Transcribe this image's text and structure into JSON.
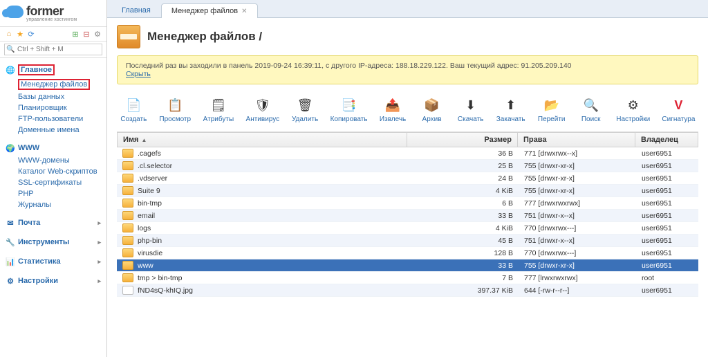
{
  "logo": {
    "text": "former",
    "sub": "управление хостингом"
  },
  "search": {
    "placeholder": "Ctrl + Shift + M"
  },
  "nav": {
    "main": {
      "label": "Главное",
      "items": [
        "Менеджер файлов",
        "Базы данных",
        "Планировщик",
        "FTP-пользователи",
        "Доменные имена"
      ]
    },
    "www": {
      "label": "WWW",
      "items": [
        "WWW-домены",
        "Каталог Web-скриптов",
        "SSL-сертификаты",
        "PHP",
        "Журналы"
      ]
    },
    "mail": {
      "label": "Почта"
    },
    "tools": {
      "label": "Инструменты"
    },
    "stats": {
      "label": "Статистика"
    },
    "settings": {
      "label": "Настройки"
    }
  },
  "tabs": {
    "home": "Главная",
    "fm": "Менеджер файлов"
  },
  "title": "Менеджер файлов /",
  "notice": {
    "text": "Последний раз вы заходили в панель 2019-09-24 16:39:11, с другого IP-адреса: 188.18.229.122. Ваш текущий адрес: 91.205.209.140",
    "hide": "Скрыть"
  },
  "toolbar": {
    "create": "Создать",
    "view": "Просмотр",
    "attrs": "Атрибуты",
    "antivirus": "Антивирус",
    "delete": "Удалить",
    "copy": "Копировать",
    "extract": "Извлечь",
    "archive": "Архив",
    "download": "Скачать",
    "upload": "Закачать",
    "goto": "Перейти",
    "search": "Поиск",
    "settings": "Настройки",
    "signature": "Сигнатура"
  },
  "columns": {
    "name": "Имя",
    "size": "Размер",
    "perm": "Права",
    "owner": "Владелец"
  },
  "rows": [
    {
      "name": ".cagefs",
      "size": "36 B",
      "perm": "771 [drwxrwx--x]",
      "owner": "user6951",
      "type": "dir",
      "selected": false
    },
    {
      "name": ".cl.selector",
      "size": "25 B",
      "perm": "755 [drwxr-xr-x]",
      "owner": "user6951",
      "type": "dir",
      "selected": false
    },
    {
      "name": ".vdserver",
      "size": "24 B",
      "perm": "755 [drwxr-xr-x]",
      "owner": "user6951",
      "type": "dir",
      "selected": false
    },
    {
      "name": "Suite 9",
      "size": "4 KiB",
      "perm": "755 [drwxr-xr-x]",
      "owner": "user6951",
      "type": "dir",
      "selected": false
    },
    {
      "name": "bin-tmp",
      "size": "6 B",
      "perm": "777 [drwxrwxrwx]",
      "owner": "user6951",
      "type": "dir",
      "selected": false
    },
    {
      "name": "email",
      "size": "33 B",
      "perm": "751 [drwxr-x--x]",
      "owner": "user6951",
      "type": "dir",
      "selected": false
    },
    {
      "name": "logs",
      "size": "4 KiB",
      "perm": "770 [drwxrwx---]",
      "owner": "user6951",
      "type": "dir",
      "selected": false
    },
    {
      "name": "php-bin",
      "size": "45 B",
      "perm": "751 [drwxr-x--x]",
      "owner": "user6951",
      "type": "dir",
      "selected": false
    },
    {
      "name": "virusdie",
      "size": "128 B",
      "perm": "770 [drwxrwx---]",
      "owner": "user6951",
      "type": "dir",
      "selected": false
    },
    {
      "name": "www",
      "size": "33 B",
      "perm": "755 [drwxr-xr-x]",
      "owner": "user6951",
      "type": "dir",
      "selected": true
    },
    {
      "name": "tmp > bin-tmp",
      "size": "7 B",
      "perm": "777 [lrwxrwxrwx]",
      "owner": "root",
      "type": "dir",
      "selected": false
    },
    {
      "name": "fND4sQ-khIQ.jpg",
      "size": "397.37 KiB",
      "perm": "644 [-rw-r--r--]",
      "owner": "user6951",
      "type": "file",
      "selected": false
    }
  ]
}
